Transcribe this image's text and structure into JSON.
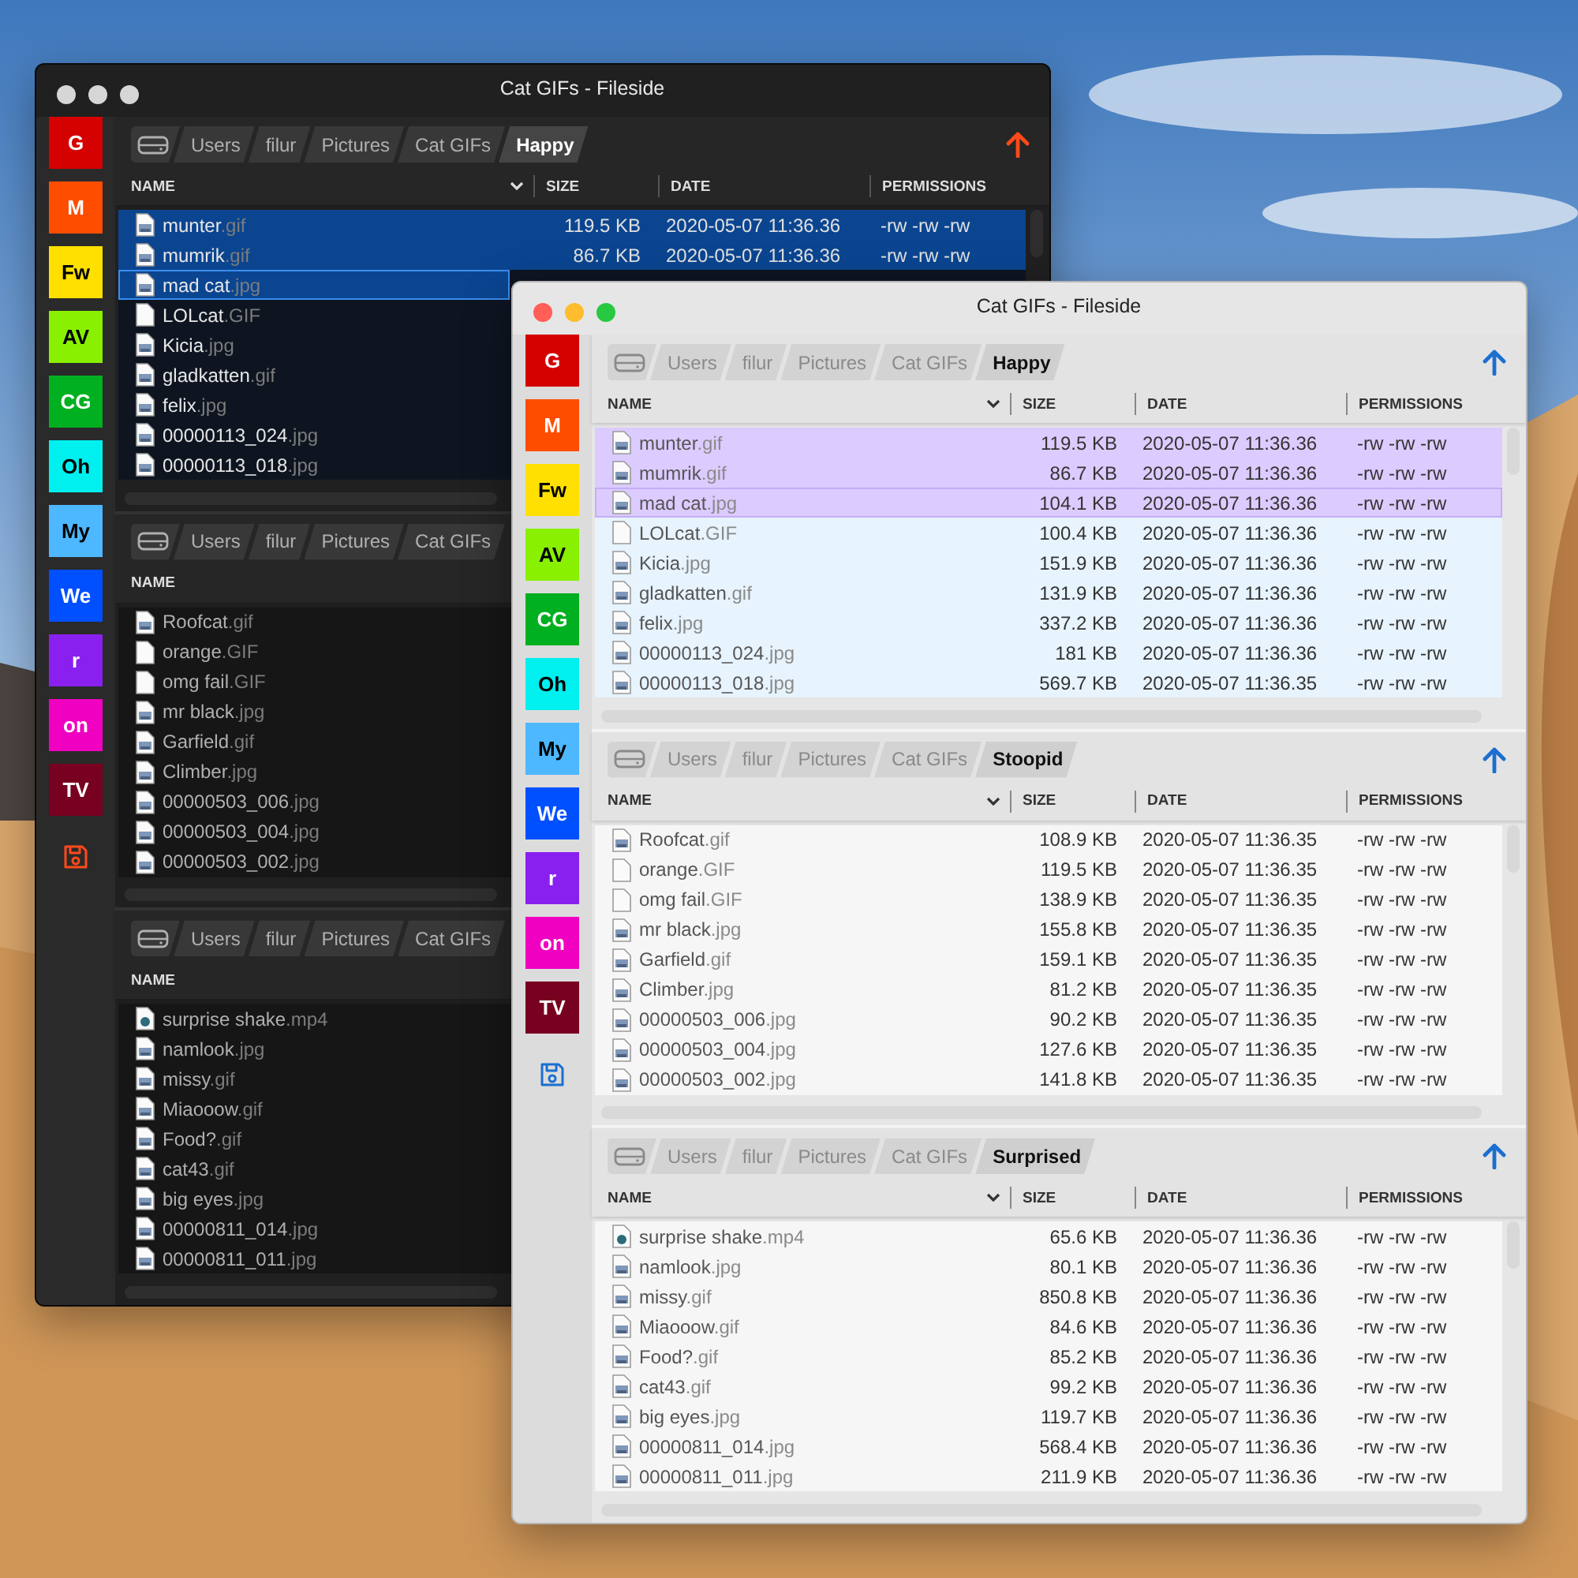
{
  "windows": [
    {
      "kind": "dark",
      "active": false,
      "title": "Cat GIFs - Fileside",
      "tags": [
        {
          "label": "G",
          "color": "#d50000"
        },
        {
          "label": "M",
          "color": "#ff4d00"
        },
        {
          "label": "Fw",
          "color": "#ffe000"
        },
        {
          "label": "AV",
          "color": "#88f000"
        },
        {
          "label": "CG",
          "color": "#00b020"
        },
        {
          "label": "Oh",
          "color": "#00f0f0"
        },
        {
          "label": "My",
          "color": "#4db8ff"
        },
        {
          "label": "We",
          "color": "#0050ff"
        },
        {
          "label": "r",
          "color": "#8a20f0"
        },
        {
          "label": "on",
          "color": "#f000c0"
        },
        {
          "label": "TV",
          "color": "#780020"
        }
      ],
      "panes": [
        {
          "focused": true,
          "up_button": true,
          "path": [
            {
              "label": "Users",
              "selected": false
            },
            {
              "label": "filur",
              "selected": false
            },
            {
              "label": "Pictures",
              "selected": false
            },
            {
              "label": "Cat GIFs",
              "selected": false
            },
            {
              "label": "Happy",
              "selected": true
            }
          ],
          "columns": [
            "NAME",
            "SIZE",
            "DATE",
            "PERMISSIONS"
          ],
          "files": [
            {
              "name": "munter",
              "ext": ".gif",
              "kind": "image",
              "size": "119.5 KB",
              "date": "2020-05-07 11:36.36",
              "permissions": "-rw -rw -rw",
              "selected": true,
              "cursor": false
            },
            {
              "name": "mumrik",
              "ext": ".gif",
              "kind": "image",
              "size": "86.7 KB",
              "date": "2020-05-07 11:36.36",
              "permissions": "-rw -rw -rw",
              "selected": true,
              "cursor": false
            },
            {
              "name": "mad cat",
              "ext": ".jpg",
              "kind": "image",
              "selected": true,
              "cursor": true
            },
            {
              "name": "LOLcat",
              "ext": ".GIF",
              "kind": "blank",
              "selected": false,
              "cursor": false
            },
            {
              "name": "Kicia",
              "ext": ".jpg",
              "kind": "image",
              "selected": false,
              "cursor": false
            },
            {
              "name": "gladkatten",
              "ext": ".gif",
              "kind": "image",
              "selected": false,
              "cursor": false
            },
            {
              "name": "felix",
              "ext": ".jpg",
              "kind": "image",
              "selected": false,
              "cursor": false
            },
            {
              "name": "00000113_024",
              "ext": ".jpg",
              "kind": "image",
              "selected": false,
              "cursor": false
            },
            {
              "name": "00000113_018",
              "ext": ".jpg",
              "kind": "image",
              "selected": false,
              "cursor": false
            }
          ]
        },
        {
          "focused": false,
          "up_button": false,
          "path": [
            {
              "label": "Users",
              "selected": false
            },
            {
              "label": "filur",
              "selected": false
            },
            {
              "label": "Pictures",
              "selected": false
            },
            {
              "label": "Cat GIFs",
              "selected": false
            }
          ],
          "columns": [
            "NAME"
          ],
          "files": [
            {
              "name": "Roofcat",
              "ext": ".gif",
              "kind": "image",
              "selected": false,
              "cursor": false
            },
            {
              "name": "orange",
              "ext": ".GIF",
              "kind": "blank",
              "selected": false,
              "cursor": false
            },
            {
              "name": "omg fail",
              "ext": ".GIF",
              "kind": "blank",
              "selected": false,
              "cursor": false
            },
            {
              "name": "mr black",
              "ext": ".jpg",
              "kind": "image",
              "selected": false,
              "cursor": false
            },
            {
              "name": "Garfield",
              "ext": ".gif",
              "kind": "image",
              "selected": false,
              "cursor": false
            },
            {
              "name": "Climber",
              "ext": ".jpg",
              "kind": "image",
              "selected": false,
              "cursor": false
            },
            {
              "name": "00000503_006",
              "ext": ".jpg",
              "kind": "image",
              "selected": false,
              "cursor": false
            },
            {
              "name": "00000503_004",
              "ext": ".jpg",
              "kind": "image",
              "selected": false,
              "cursor": false
            },
            {
              "name": "00000503_002",
              "ext": ".jpg",
              "kind": "image",
              "selected": false,
              "cursor": false
            }
          ]
        },
        {
          "focused": false,
          "up_button": false,
          "path": [
            {
              "label": "Users",
              "selected": false
            },
            {
              "label": "filur",
              "selected": false
            },
            {
              "label": "Pictures",
              "selected": false
            },
            {
              "label": "Cat GIFs",
              "selected": false
            }
          ],
          "columns": [
            "NAME"
          ],
          "files": [
            {
              "name": "surprise shake",
              "ext": ".mp4",
              "kind": "video",
              "selected": false,
              "cursor": false
            },
            {
              "name": "namlook",
              "ext": ".jpg",
              "kind": "image",
              "selected": false,
              "cursor": false
            },
            {
              "name": "missy",
              "ext": ".gif",
              "kind": "image",
              "selected": false,
              "cursor": false
            },
            {
              "name": "Miaooow",
              "ext": ".gif",
              "kind": "image",
              "selected": false,
              "cursor": false
            },
            {
              "name": "Food?",
              "ext": ".gif",
              "kind": "image",
              "selected": false,
              "cursor": false
            },
            {
              "name": "cat43",
              "ext": ".gif",
              "kind": "image",
              "selected": false,
              "cursor": false
            },
            {
              "name": "big eyes",
              "ext": ".jpg",
              "kind": "image",
              "selected": false,
              "cursor": false
            },
            {
              "name": "00000811_014",
              "ext": ".jpg",
              "kind": "image",
              "selected": false,
              "cursor": false
            },
            {
              "name": "00000811_011",
              "ext": ".jpg",
              "kind": "image",
              "selected": false,
              "cursor": false
            }
          ]
        }
      ]
    },
    {
      "kind": "light",
      "active": true,
      "title": "Cat GIFs - Fileside",
      "tags": [
        {
          "label": "G",
          "color": "#d50000"
        },
        {
          "label": "M",
          "color": "#ff4d00"
        },
        {
          "label": "Fw",
          "color": "#ffe000"
        },
        {
          "label": "AV",
          "color": "#88f000"
        },
        {
          "label": "CG",
          "color": "#00b020"
        },
        {
          "label": "Oh",
          "color": "#00f0f0"
        },
        {
          "label": "My",
          "color": "#4db8ff"
        },
        {
          "label": "We",
          "color": "#0050ff"
        },
        {
          "label": "r",
          "color": "#8a20f0"
        },
        {
          "label": "on",
          "color": "#f000c0"
        },
        {
          "label": "TV",
          "color": "#780020"
        }
      ],
      "panes": [
        {
          "focused": true,
          "up_button": true,
          "path": [
            {
              "label": "Users",
              "selected": false
            },
            {
              "label": "filur",
              "selected": false
            },
            {
              "label": "Pictures",
              "selected": false
            },
            {
              "label": "Cat GIFs",
              "selected": false
            },
            {
              "label": "Happy",
              "selected": true
            }
          ],
          "columns": [
            "NAME",
            "SIZE",
            "DATE",
            "PERMISSIONS"
          ],
          "files": [
            {
              "name": "munter",
              "ext": ".gif",
              "kind": "image",
              "size": "119.5 KB",
              "date": "2020-05-07 11:36.36",
              "permissions": "-rw -rw -rw",
              "selected": true,
              "cursor": false
            },
            {
              "name": "mumrik",
              "ext": ".gif",
              "kind": "image",
              "size": "86.7 KB",
              "date": "2020-05-07 11:36.36",
              "permissions": "-rw -rw -rw",
              "selected": true,
              "cursor": false
            },
            {
              "name": "mad cat",
              "ext": ".jpg",
              "kind": "image",
              "size": "104.1 KB",
              "date": "2020-05-07 11:36.36",
              "permissions": "-rw -rw -rw",
              "selected": true,
              "cursor": true
            },
            {
              "name": "LOLcat",
              "ext": ".GIF",
              "kind": "blank",
              "size": "100.4 KB",
              "date": "2020-05-07 11:36.36",
              "permissions": "-rw -rw -rw",
              "selected": false,
              "cursor": false
            },
            {
              "name": "Kicia",
              "ext": ".jpg",
              "kind": "image",
              "size": "151.9 KB",
              "date": "2020-05-07 11:36.36",
              "permissions": "-rw -rw -rw",
              "selected": false,
              "cursor": false
            },
            {
              "name": "gladkatten",
              "ext": ".gif",
              "kind": "image",
              "size": "131.9 KB",
              "date": "2020-05-07 11:36.36",
              "permissions": "-rw -rw -rw",
              "selected": false,
              "cursor": false
            },
            {
              "name": "felix",
              "ext": ".jpg",
              "kind": "image",
              "size": "337.2 KB",
              "date": "2020-05-07 11:36.36",
              "permissions": "-rw -rw -rw",
              "selected": false,
              "cursor": false
            },
            {
              "name": "00000113_024",
              "ext": ".jpg",
              "kind": "image",
              "size": "181 KB",
              "date": "2020-05-07 11:36.36",
              "permissions": "-rw -rw -rw",
              "selected": false,
              "cursor": false
            },
            {
              "name": "00000113_018",
              "ext": ".jpg",
              "kind": "image",
              "size": "569.7 KB",
              "date": "2020-05-07 11:36.35",
              "permissions": "-rw -rw -rw",
              "selected": false,
              "cursor": false
            }
          ]
        },
        {
          "focused": false,
          "up_button": true,
          "path": [
            {
              "label": "Users",
              "selected": false
            },
            {
              "label": "filur",
              "selected": false
            },
            {
              "label": "Pictures",
              "selected": false
            },
            {
              "label": "Cat GIFs",
              "selected": false
            },
            {
              "label": "Stoopid",
              "selected": true
            }
          ],
          "columns": [
            "NAME",
            "SIZE",
            "DATE",
            "PERMISSIONS"
          ],
          "files": [
            {
              "name": "Roofcat",
              "ext": ".gif",
              "kind": "image",
              "size": "108.9 KB",
              "date": "2020-05-07 11:36.35",
              "permissions": "-rw -rw -rw",
              "selected": false,
              "cursor": false
            },
            {
              "name": "orange",
              "ext": ".GIF",
              "kind": "blank",
              "size": "119.5 KB",
              "date": "2020-05-07 11:36.35",
              "permissions": "-rw -rw -rw",
              "selected": false,
              "cursor": false
            },
            {
              "name": "omg fail",
              "ext": ".GIF",
              "kind": "blank",
              "size": "138.9 KB",
              "date": "2020-05-07 11:36.35",
              "permissions": "-rw -rw -rw",
              "selected": false,
              "cursor": false
            },
            {
              "name": "mr black",
              "ext": ".jpg",
              "kind": "image",
              "size": "155.8 KB",
              "date": "2020-05-07 11:36.35",
              "permissions": "-rw -rw -rw",
              "selected": false,
              "cursor": false
            },
            {
              "name": "Garfield",
              "ext": ".gif",
              "kind": "image",
              "size": "159.1 KB",
              "date": "2020-05-07 11:36.35",
              "permissions": "-rw -rw -rw",
              "selected": false,
              "cursor": false
            },
            {
              "name": "Climber",
              "ext": ".jpg",
              "kind": "image",
              "size": "81.2 KB",
              "date": "2020-05-07 11:36.35",
              "permissions": "-rw -rw -rw",
              "selected": false,
              "cursor": false
            },
            {
              "name": "00000503_006",
              "ext": ".jpg",
              "kind": "image",
              "size": "90.2 KB",
              "date": "2020-05-07 11:36.35",
              "permissions": "-rw -rw -rw",
              "selected": false,
              "cursor": false
            },
            {
              "name": "00000503_004",
              "ext": ".jpg",
              "kind": "image",
              "size": "127.6 KB",
              "date": "2020-05-07 11:36.35",
              "permissions": "-rw -rw -rw",
              "selected": false,
              "cursor": false
            },
            {
              "name": "00000503_002",
              "ext": ".jpg",
              "kind": "image",
              "size": "141.8 KB",
              "date": "2020-05-07 11:36.35",
              "permissions": "-rw -rw -rw",
              "selected": false,
              "cursor": false
            }
          ]
        },
        {
          "focused": false,
          "up_button": true,
          "path": [
            {
              "label": "Users",
              "selected": false
            },
            {
              "label": "filur",
              "selected": false
            },
            {
              "label": "Pictures",
              "selected": false
            },
            {
              "label": "Cat GIFs",
              "selected": false
            },
            {
              "label": "Surprised",
              "selected": true
            }
          ],
          "columns": [
            "NAME",
            "SIZE",
            "DATE",
            "PERMISSIONS"
          ],
          "files": [
            {
              "name": "surprise shake",
              "ext": ".mp4",
              "kind": "video",
              "size": "65.6 KB",
              "date": "2020-05-07 11:36.36",
              "permissions": "-rw -rw -rw",
              "selected": false,
              "cursor": false
            },
            {
              "name": "namlook",
              "ext": ".jpg",
              "kind": "image",
              "size": "80.1 KB",
              "date": "2020-05-07 11:36.36",
              "permissions": "-rw -rw -rw",
              "selected": false,
              "cursor": false
            },
            {
              "name": "missy",
              "ext": ".gif",
              "kind": "image",
              "size": "850.8 KB",
              "date": "2020-05-07 11:36.36",
              "permissions": "-rw -rw -rw",
              "selected": false,
              "cursor": false
            },
            {
              "name": "Miaooow",
              "ext": ".gif",
              "kind": "image",
              "size": "84.6 KB",
              "date": "2020-05-07 11:36.36",
              "permissions": "-rw -rw -rw",
              "selected": false,
              "cursor": false
            },
            {
              "name": "Food?",
              "ext": ".gif",
              "kind": "image",
              "size": "85.2 KB",
              "date": "2020-05-07 11:36.36",
              "permissions": "-rw -rw -rw",
              "selected": false,
              "cursor": false
            },
            {
              "name": "cat43",
              "ext": ".gif",
              "kind": "image",
              "size": "99.2 KB",
              "date": "2020-05-07 11:36.36",
              "permissions": "-rw -rw -rw",
              "selected": false,
              "cursor": false
            },
            {
              "name": "big eyes",
              "ext": ".jpg",
              "kind": "image",
              "size": "119.7 KB",
              "date": "2020-05-07 11:36.36",
              "permissions": "-rw -rw -rw",
              "selected": false,
              "cursor": false
            },
            {
              "name": "00000811_014",
              "ext": ".jpg",
              "kind": "image",
              "size": "568.4 KB",
              "date": "2020-05-07 11:36.36",
              "permissions": "-rw -rw -rw",
              "selected": false,
              "cursor": false
            },
            {
              "name": "00000811_011",
              "ext": ".jpg",
              "kind": "image",
              "size": "211.9 KB",
              "date": "2020-05-07 11:36.36",
              "permissions": "-rw -rw -rw",
              "selected": false,
              "cursor": false
            }
          ]
        }
      ]
    }
  ]
}
